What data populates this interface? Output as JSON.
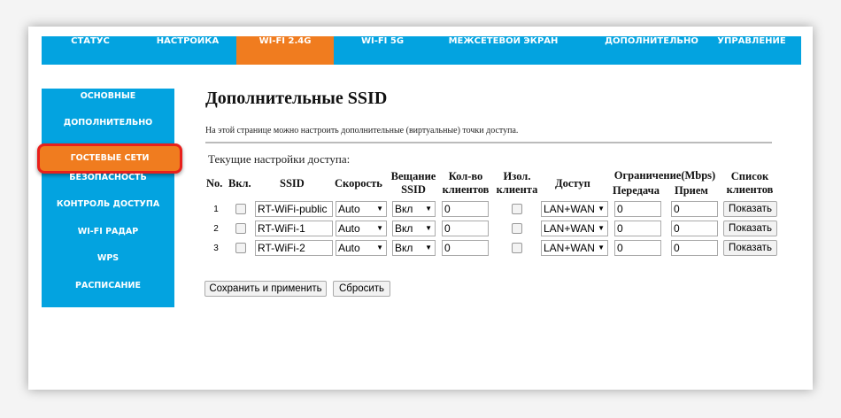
{
  "nav": {
    "tabs": [
      "СТАТУС",
      "НАСТРОЙКА",
      "WI-FI 2.4G",
      "WI-FI 5G",
      "МЕЖСЕТЕВОЙ ЭКРАН",
      "ДОПОЛНИТЕЛЬНО",
      "УПРАВЛЕНИЕ"
    ],
    "active": "WI-FI 2.4G"
  },
  "sidebar": {
    "items": [
      "ОСНОВНЫЕ",
      "ДОПОЛНИТЕЛЬНО",
      "ГОСТЕВЫЕ СЕТИ",
      "БЕЗОПАСНОСТЬ",
      "КОНТРОЛЬ ДОСТУПА",
      "WI-FI РАДАР",
      "WPS",
      "РАСПИСАНИЕ"
    ],
    "active": "ГОСТЕВЫЕ СЕТИ"
  },
  "page": {
    "title": "Дополнительные SSID",
    "description": "На этой странице можно настроить дополнительные (виртуальные) точки доступа.",
    "subtitle": "Текущие настройки доступа:"
  },
  "table": {
    "headers": {
      "no": "No.",
      "on": "Вкл.",
      "ssid": "SSID",
      "speed": "Скорость",
      "broadcast_1": "Вещание",
      "broadcast_2": "SSID",
      "count_1": "Кол-во",
      "count_2": "клиентов",
      "iso_1": "Изол.",
      "iso_2": "клиента",
      "access": "Доступ",
      "limit": "Ограничение(Mbps)",
      "tx": "Передача",
      "rx": "Прием",
      "list_1": "Список",
      "list_2": "клиентов"
    },
    "rows": [
      {
        "no": "1",
        "ssid": "RT-WiFi-public",
        "speed": "Auto",
        "broadcast": "Вкл",
        "count": "0",
        "access": "LAN+WAN",
        "tx": "0",
        "rx": "0",
        "button": "Показать"
      },
      {
        "no": "2",
        "ssid": "RT-WiFi-1",
        "speed": "Auto",
        "broadcast": "Вкл",
        "count": "0",
        "access": "LAN+WAN",
        "tx": "0",
        "rx": "0",
        "button": "Показать"
      },
      {
        "no": "3",
        "ssid": "RT-WiFi-2",
        "speed": "Auto",
        "broadcast": "Вкл",
        "count": "0",
        "access": "LAN+WAN",
        "tx": "0",
        "rx": "0",
        "button": "Показать"
      }
    ]
  },
  "actions": {
    "save": "Сохранить и применить",
    "reset": "Сбросить"
  },
  "colors": {
    "blue": "#03a3e0",
    "orange": "#f07c1f",
    "highlight": "#e8201c"
  }
}
